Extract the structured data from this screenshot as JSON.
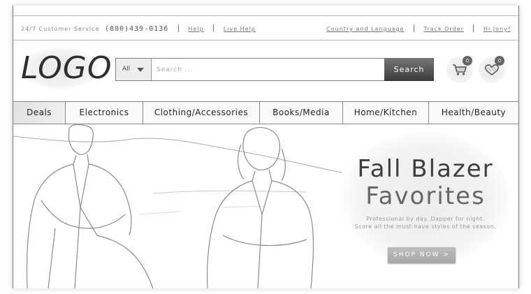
{
  "topbar": {
    "service_label": "24/7 Customer Service",
    "phone": "(800)439-0136",
    "help": "Help",
    "live_help": "Live Help",
    "country_language": "Country and Language",
    "track_order": "Track Order",
    "greeting": "Hi Jony!"
  },
  "header": {
    "logo": "LOGO",
    "search": {
      "category": "All",
      "placeholder": "Search ...",
      "button": "Search"
    },
    "cart_count": "0",
    "wishlist_count": "0"
  },
  "nav": {
    "items": [
      "Deals",
      "Electronics",
      "Clothing/Accessories",
      "Books/Media",
      "Home/Kitchen",
      "Health/Beauty"
    ]
  },
  "hero": {
    "title_line1": "Fall Blazer",
    "title_line2": "Favorites",
    "subtitle_line1": "Professional by day. Dapper for night.",
    "subtitle_line2": "Score all the must-have styles of the season.",
    "cta": "SHOP NOW >"
  },
  "colors": {
    "accent_dark": "#3a3a3a",
    "badge": "#666666",
    "cta": "#b0b0b0"
  },
  "icons": [
    "cart-icon",
    "heart-icon",
    "dropdown-arrow-icon"
  ]
}
